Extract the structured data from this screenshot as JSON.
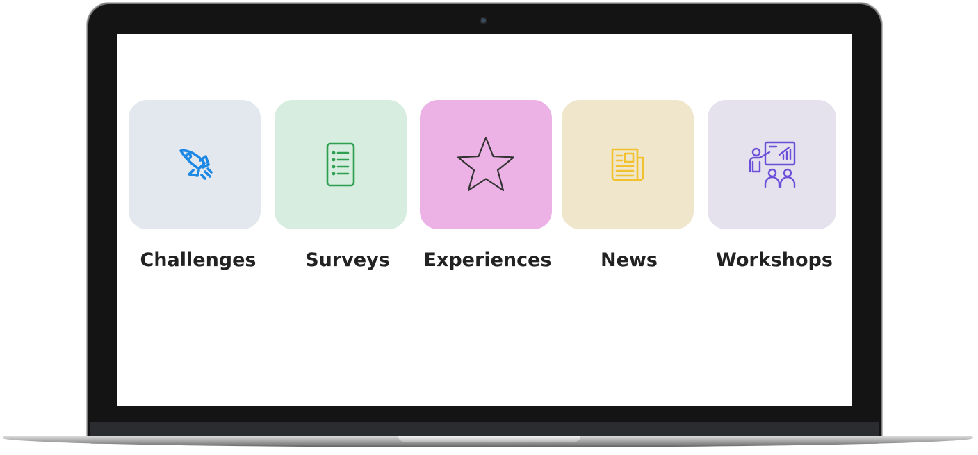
{
  "categories": [
    {
      "label": "Challenges",
      "icon": "rocket-icon",
      "bg": "#e3e8ef",
      "icon_color": "#1e88e5"
    },
    {
      "label": "Surveys",
      "icon": "list-icon",
      "bg": "#d6ede0",
      "icon_color": "#2e9e4f"
    },
    {
      "label": "Experiences",
      "icon": "star-icon",
      "bg": "#ecb2e5",
      "icon_color": "#333333"
    },
    {
      "label": "News",
      "icon": "newspaper-icon",
      "bg": "#efe6cc",
      "icon_color": "#f2c12e"
    },
    {
      "label": "Workshops",
      "icon": "presentation-icon",
      "bg": "#e5e2ee",
      "icon_color": "#6b4fd8"
    }
  ]
}
